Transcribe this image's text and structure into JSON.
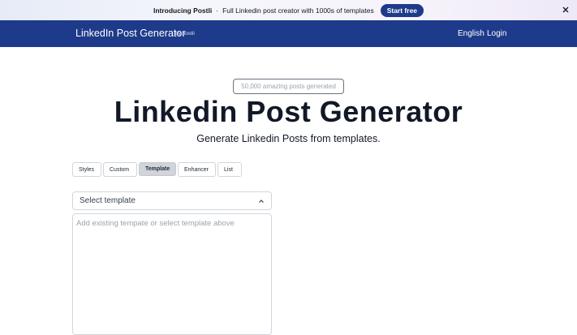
{
  "promo": {
    "strong_text": "Introducing Postli",
    "separator": "·",
    "text": "Full Linkedin post creator with 1000s of templates",
    "cta_label": "Start free",
    "close_icon": "close-icon"
  },
  "nav": {
    "brand": "LinkedIn Post Generator",
    "by": "by postli",
    "language": "English",
    "login": "Login"
  },
  "hero": {
    "counter": "50,000 amazing posts generated",
    "title": "Linkedin Post Generator",
    "subtitle": "Generate Linkedin Posts from templates."
  },
  "tabs": [
    {
      "label": "Styles"
    },
    {
      "label": "Custom"
    },
    {
      "label": "Template"
    },
    {
      "label": "Enhancer"
    },
    {
      "label": "List"
    }
  ],
  "active_tab": "Template",
  "template_select": {
    "value": "Select template",
    "icon": "chevron-up-icon"
  },
  "editor": {
    "placeholder": "Add existing tempate or select template above"
  },
  "colors": {
    "nav_bg": "#1e3a8a",
    "cta_bg": "#1e3a8a",
    "active_tab_bg": "#d1d5db"
  }
}
